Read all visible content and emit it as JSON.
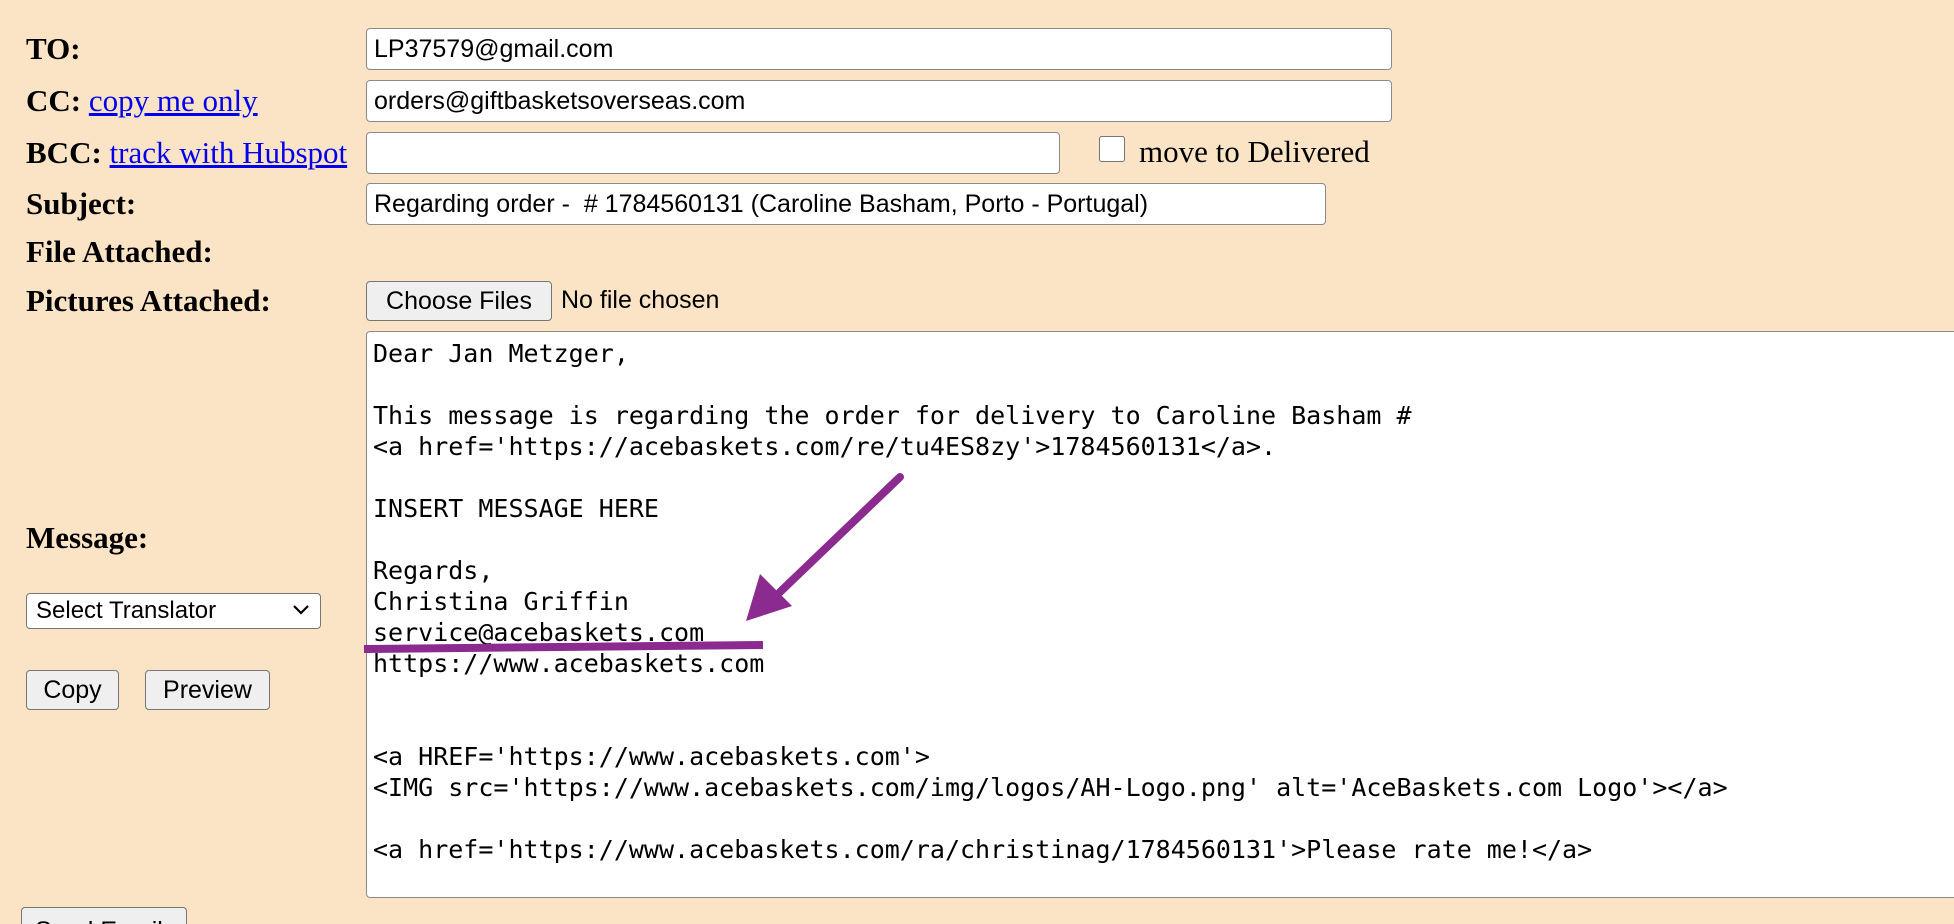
{
  "form": {
    "to": {
      "label": "TO:",
      "value": "LP37579@gmail.com"
    },
    "cc": {
      "label": "CC:",
      "link": "copy me only",
      "value": "orders@giftbasketsoverseas.com"
    },
    "bcc": {
      "label": "BCC:",
      "link": "track with Hubspot",
      "value": "",
      "checkbox_label": "move to Delivered"
    },
    "subject": {
      "label": "Subject:",
      "value": "Regarding order -  # 1784560131 (Caroline Basham, Porto - Portugal)"
    },
    "file_attached": {
      "label": "File Attached:"
    },
    "pictures_attached": {
      "label": "Pictures Attached:",
      "button": "Choose Files",
      "status": "No file chosen"
    },
    "message": {
      "label": "Message:",
      "body": "Dear Jan Metzger,\n\nThis message is regarding the order for delivery to Caroline Basham #\n<a href='https://acebaskets.com/re/tu4ES8zy'>1784560131</a>.\n\nINSERT MESSAGE HERE\n\nRegards,\nChristina Griffin\nservice@acebaskets.com\nhttps://www.acebaskets.com\n\n\n<a HREF='https://www.acebaskets.com'>\n<IMG src='https://www.acebaskets.com/img/logos/AH-Logo.png' alt='AceBaskets.com Logo'></a>\n\n<a href='https://www.acebaskets.com/ra/christinag/1784560131'>Please rate me!</a>"
    },
    "translator": {
      "selected": "Select Translator"
    },
    "buttons": {
      "copy": "Copy",
      "preview": "Preview",
      "send": "Send Email"
    }
  },
  "annotation": {
    "color": "#8b2a8f"
  }
}
